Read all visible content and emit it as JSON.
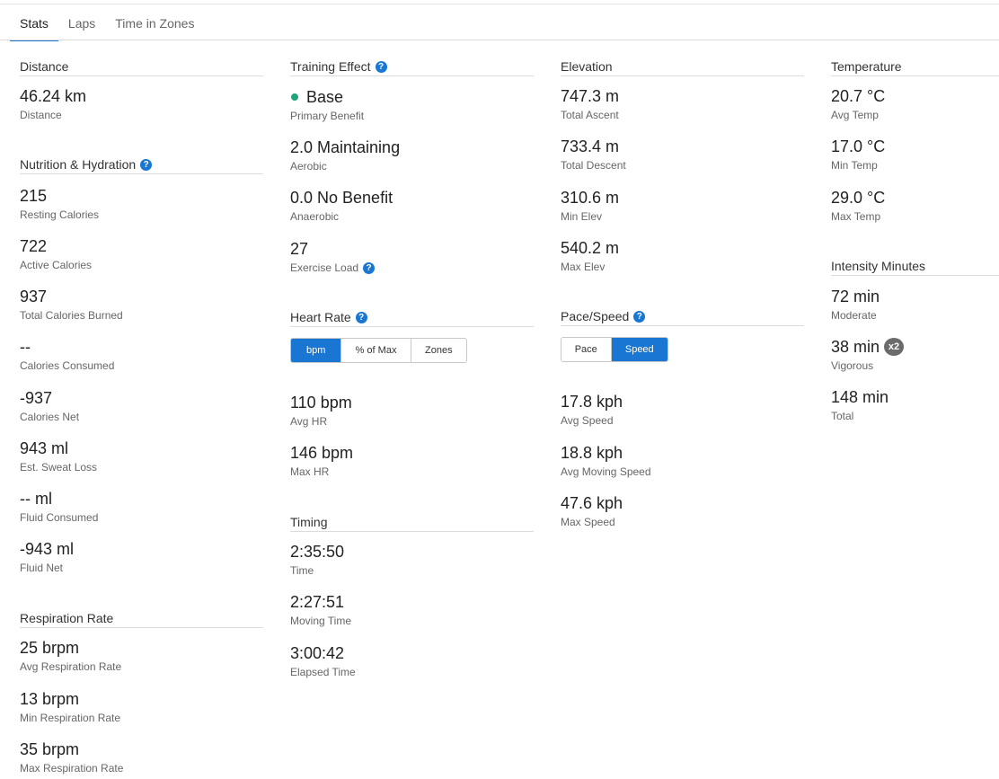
{
  "tabs": [
    "Stats",
    "Laps",
    "Time in Zones"
  ],
  "help_glyph": "?",
  "distance": {
    "title": "Distance",
    "stats": [
      {
        "value": "46.24 km",
        "label": "Distance"
      }
    ]
  },
  "nutrition": {
    "title": "Nutrition & Hydration",
    "stats": [
      {
        "value": "215",
        "label": "Resting Calories"
      },
      {
        "value": "722",
        "label": "Active Calories"
      },
      {
        "value": "937",
        "label": "Total Calories Burned"
      },
      {
        "value": "--",
        "label": "Calories Consumed"
      },
      {
        "value": "-937",
        "label": "Calories Net"
      },
      {
        "value": "943 ml",
        "label": "Est. Sweat Loss"
      },
      {
        "value": "-- ml",
        "label": "Fluid Consumed"
      },
      {
        "value": "-943 ml",
        "label": "Fluid Net"
      }
    ]
  },
  "respiration": {
    "title": "Respiration Rate",
    "stats": [
      {
        "value": "25 brpm",
        "label": "Avg Respiration Rate"
      },
      {
        "value": "13 brpm",
        "label": "Min Respiration Rate"
      },
      {
        "value": "35 brpm",
        "label": "Max Respiration Rate"
      }
    ]
  },
  "training_effect": {
    "title": "Training Effect",
    "stats": [
      {
        "value": "Base",
        "label": "Primary Benefit"
      },
      {
        "value": "2.0 Maintaining",
        "label": "Aerobic"
      },
      {
        "value": "0.0 No Benefit",
        "label": "Anaerobic"
      },
      {
        "value": "27",
        "label": "Exercise Load"
      }
    ]
  },
  "heart_rate": {
    "title": "Heart Rate",
    "toggle": [
      "bpm",
      "% of Max",
      "Zones"
    ],
    "selected": "bpm",
    "stats": [
      {
        "value": "110 bpm",
        "label": "Avg HR"
      },
      {
        "value": "146 bpm",
        "label": "Max HR"
      }
    ]
  },
  "timing": {
    "title": "Timing",
    "stats": [
      {
        "value": "2:35:50",
        "label": "Time"
      },
      {
        "value": "2:27:51",
        "label": "Moving Time"
      },
      {
        "value": "3:00:42",
        "label": "Elapsed Time"
      }
    ]
  },
  "elevation": {
    "title": "Elevation",
    "stats": [
      {
        "value": "747.3 m",
        "label": "Total Ascent"
      },
      {
        "value": "733.4 m",
        "label": "Total Descent"
      },
      {
        "value": "310.6 m",
        "label": "Min Elev"
      },
      {
        "value": "540.2 m",
        "label": "Max Elev"
      }
    ]
  },
  "pace_speed": {
    "title": "Pace/Speed",
    "toggle": [
      "Pace",
      "Speed"
    ],
    "selected": "Speed",
    "stats": [
      {
        "value": "17.8 kph",
        "label": "Avg Speed"
      },
      {
        "value": "18.8 kph",
        "label": "Avg Moving Speed"
      },
      {
        "value": "47.6 kph",
        "label": "Max Speed"
      }
    ]
  },
  "temperature": {
    "title": "Temperature",
    "stats": [
      {
        "value": "20.7 °C",
        "label": "Avg Temp"
      },
      {
        "value": "17.0 °C",
        "label": "Min Temp"
      },
      {
        "value": "29.0 °C",
        "label": "Max Temp"
      }
    ]
  },
  "intensity": {
    "title": "Intensity Minutes",
    "stats": [
      {
        "value": "72 min",
        "label": "Moderate"
      },
      {
        "value": "38 min",
        "label": "Vigorous",
        "badge": "x2"
      },
      {
        "value": "148 min",
        "label": "Total"
      }
    ]
  },
  "colors": {
    "accent": "#1976d2",
    "primary_benefit_dot": "#21a37c",
    "badge": "#6b6b6b"
  }
}
